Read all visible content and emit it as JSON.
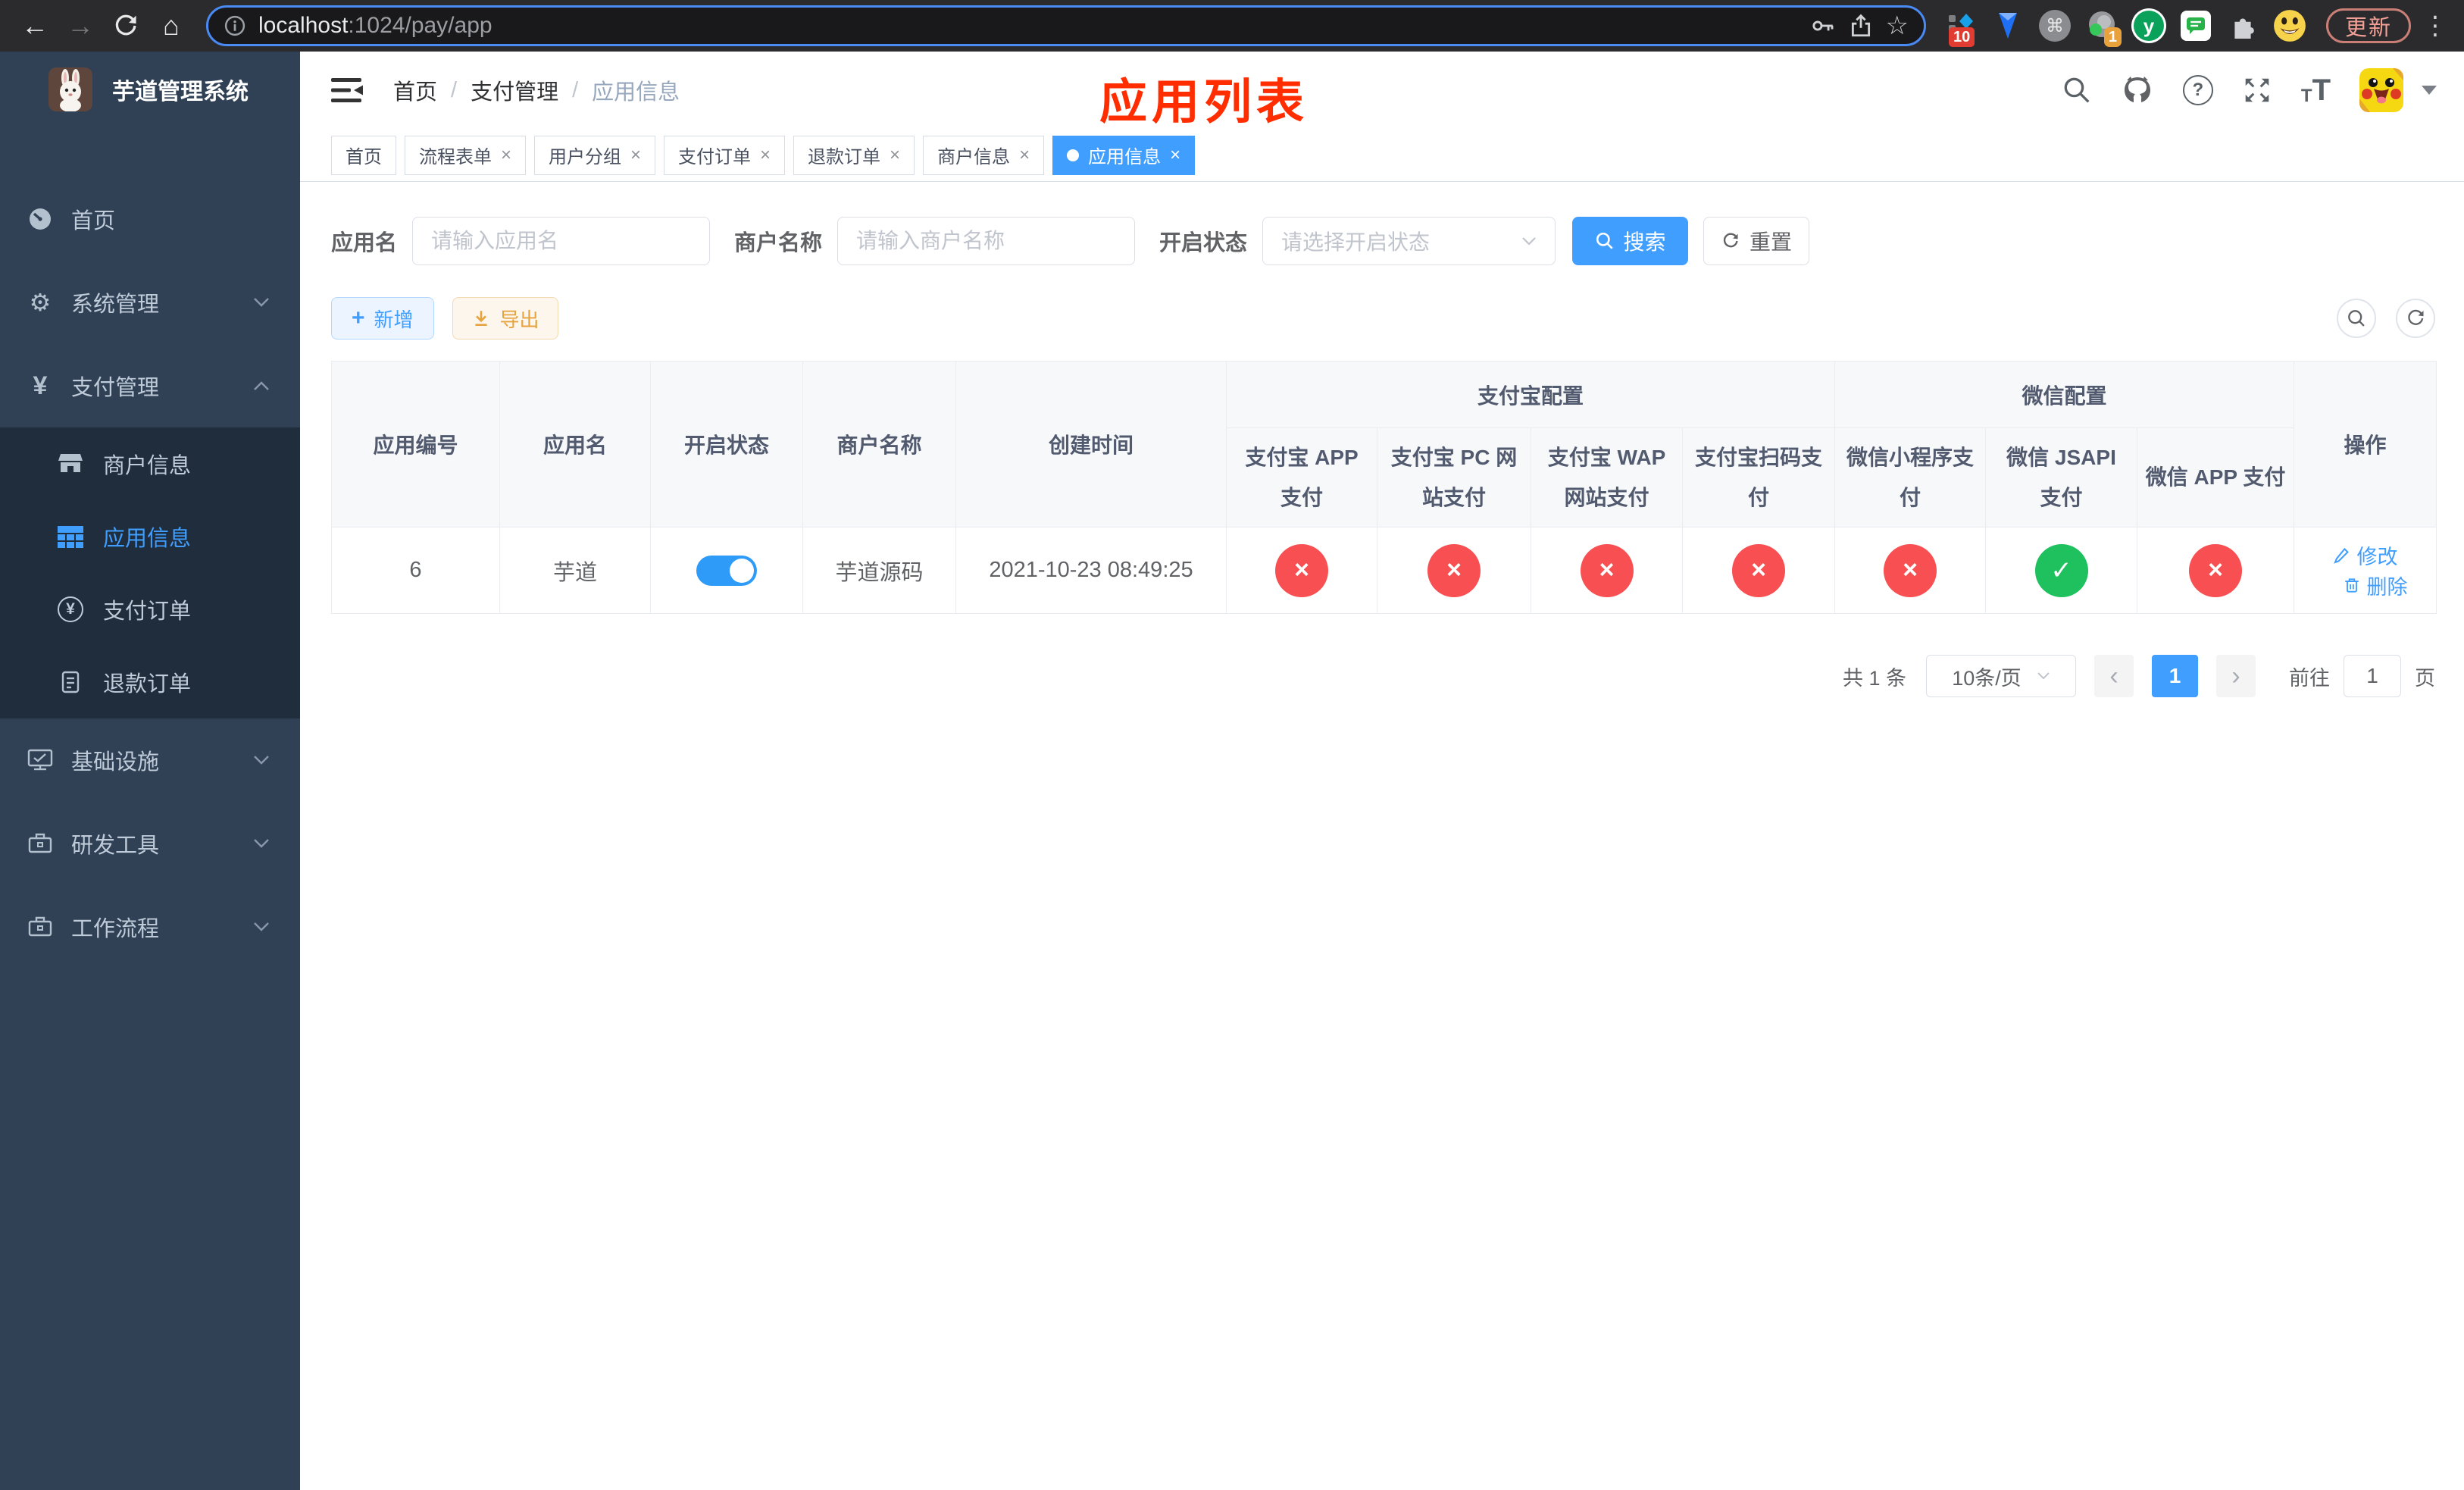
{
  "browser": {
    "url_host": "localhost",
    "url_rest": ":1024/pay/app",
    "update_label": "更新",
    "ext_badge_1": "10",
    "ext_badge_2": "1",
    "ext_y_letter": "y"
  },
  "sidebar": {
    "title": "芋道管理系统",
    "menu": [
      {
        "label": "首页"
      },
      {
        "label": "系统管理"
      },
      {
        "label": "支付管理"
      },
      {
        "label": "商户信息"
      },
      {
        "label": "应用信息"
      },
      {
        "label": "支付订单"
      },
      {
        "label": "退款订单"
      },
      {
        "label": "基础设施"
      },
      {
        "label": "研发工具"
      },
      {
        "label": "工作流程"
      }
    ]
  },
  "breadcrumb": {
    "items": [
      "首页",
      "支付管理",
      "应用信息"
    ]
  },
  "annotation": "应用列表",
  "tabs": [
    {
      "label": "首页"
    },
    {
      "label": "流程表单"
    },
    {
      "label": "用户分组"
    },
    {
      "label": "支付订单"
    },
    {
      "label": "退款订单"
    },
    {
      "label": "商户信息"
    },
    {
      "label": "应用信息"
    }
  ],
  "filters": {
    "app_name_label": "应用名",
    "app_name_placeholder": "请输入应用名",
    "merchant_label": "商户名称",
    "merchant_placeholder": "请输入商户名称",
    "status_label": "开启状态",
    "status_placeholder": "请选择开启状态",
    "search_label": "搜索",
    "reset_label": "重置"
  },
  "toolbar": {
    "add_label": "新增",
    "export_label": "导出"
  },
  "table": {
    "groups": {
      "alipay": "支付宝配置",
      "wechat": "微信配置"
    },
    "columns": {
      "id": "应用编号",
      "name": "应用名",
      "enabled": "开启状态",
      "merchant": "商户名称",
      "created": "创建时间",
      "alipay_app": "支付宝 APP 支付",
      "alipay_pc": "支付宝 PC 网站支付",
      "alipay_wap": "支付宝 WAP 网站支付",
      "alipay_qr": "支付宝扫码支付",
      "wx_lite": "微信小程序支付",
      "wx_jsapi": "微信 JSAPI 支付",
      "wx_app": "微信 APP 支付",
      "actions": "操作"
    },
    "row": {
      "id": "6",
      "name": "芋道",
      "enabled": true,
      "merchant": "芋道源码",
      "created": "2021-10-23 08:49:25",
      "status": {
        "alipay_app": false,
        "alipay_pc": false,
        "alipay_wap": false,
        "alipay_qr": false,
        "wx_lite": false,
        "wx_jsapi": true,
        "wx_app": false
      },
      "edit_label": "修改",
      "delete_label": "删除"
    }
  },
  "pagination": {
    "total": "共 1 条",
    "page_size": "10条/页",
    "current_page": "1",
    "goto_label": "前往",
    "goto_value": "1",
    "unit_label": "页"
  },
  "glyphs": {
    "back": "←",
    "forward": "→",
    "home": "⌂",
    "star": "☆",
    "kebab": "⋮",
    "command": "⌘",
    "gear": "⚙",
    "yen": "¥",
    "plus": "+",
    "question": "?",
    "font_small": "T",
    "font_large": "T",
    "breadcrumb_sep": "/",
    "tab_close": "×",
    "status_true": "✓",
    "status_false": "×",
    "prev": "‹",
    "next": "›"
  },
  "colors": {
    "accent": "#409EFF",
    "success": "#1fc15f",
    "danger": "#f85052",
    "warning": "#e6a23c",
    "sidebar_bg": "#304156",
    "submenu_bg": "#1f2d3d",
    "annotation_red": "#ff2d00"
  }
}
